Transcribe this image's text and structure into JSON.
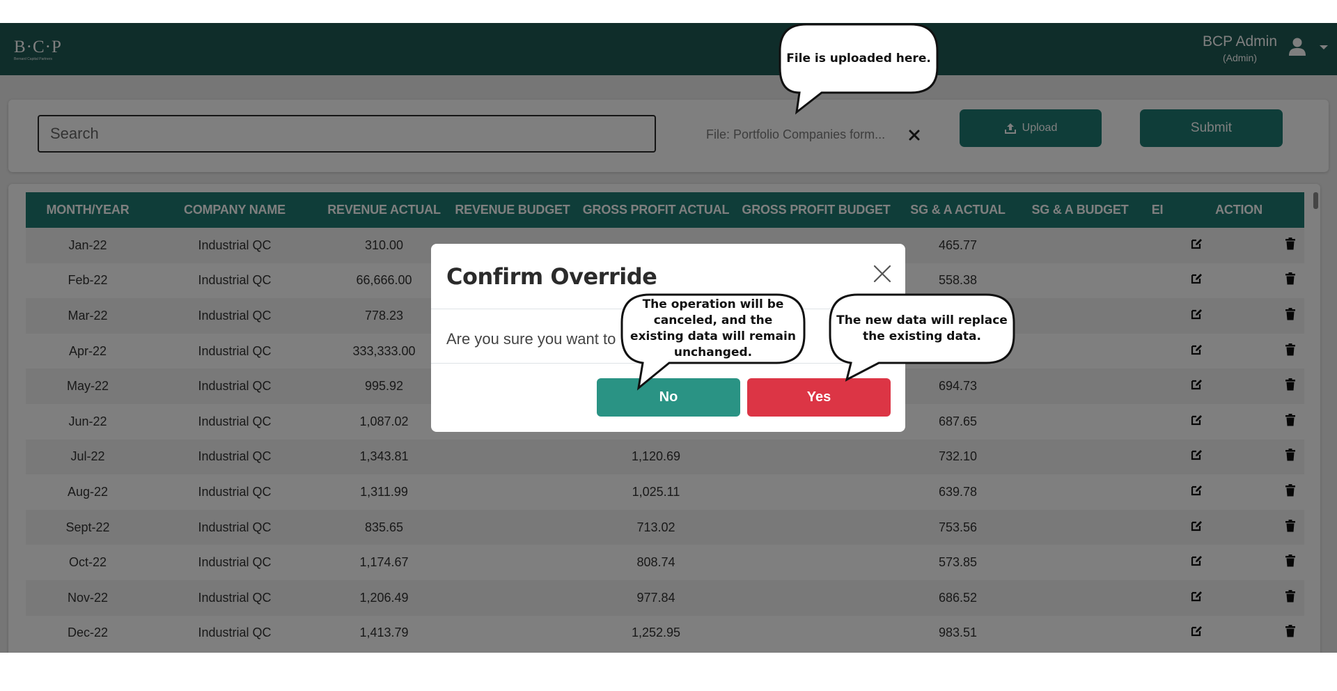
{
  "header": {
    "logo_text": "B·C·P",
    "logo_subtext": "Bernard Capital Partners",
    "user_name": "BCP Admin",
    "user_role": "(Admin)",
    "brand_color": "#1f5a54",
    "icons": {
      "user": "user-icon",
      "menu": "caret-down-icon"
    }
  },
  "toolbar": {
    "search_placeholder": "Search",
    "file_label": "File: Portfolio Companies form...",
    "upload_label": "Upload",
    "submit_label": "Submit",
    "accent_color": "#1f7b72"
  },
  "table": {
    "columns": [
      "MONTH/YEAR",
      "COMPANY NAME",
      "REVENUE ACTUAL",
      "REVENUE BUDGET",
      "GROSS PROFIT ACTUAL",
      "GROSS PROFIT BUDGET",
      "SG & A ACTUAL",
      "SG & A BUDGET",
      "EI",
      "ACTION"
    ],
    "rows": [
      {
        "month": "Jan-22",
        "company": "Industrial QC",
        "rev_actual": "310.00",
        "rev_budget": "",
        "gp_actual": "",
        "gp_budget": "",
        "sga_actual": "465.77",
        "sga_budget": ""
      },
      {
        "month": "Feb-22",
        "company": "Industrial QC",
        "rev_actual": "66,666.00",
        "rev_budget": "",
        "gp_actual": "",
        "gp_budget": "",
        "sga_actual": "558.38",
        "sga_budget": ""
      },
      {
        "month": "Mar-22",
        "company": "Industrial QC",
        "rev_actual": "778.23",
        "rev_budget": "",
        "gp_actual": "",
        "gp_budget": "",
        "sga_actual": "",
        "sga_budget": ""
      },
      {
        "month": "Apr-22",
        "company": "Industrial QC",
        "rev_actual": "333,333.00",
        "rev_budget": "",
        "gp_actual": "",
        "gp_budget": "",
        "sga_actual": "",
        "sga_budget": ""
      },
      {
        "month": "May-22",
        "company": "Industrial QC",
        "rev_actual": "995.92",
        "rev_budget": "",
        "gp_actual": "",
        "gp_budget": "",
        "sga_actual": "694.73",
        "sga_budget": ""
      },
      {
        "month": "Jun-22",
        "company": "Industrial QC",
        "rev_actual": "1,087.02",
        "rev_budget": "",
        "gp_actual": "",
        "gp_budget": "",
        "sga_actual": "687.65",
        "sga_budget": ""
      },
      {
        "month": "Jul-22",
        "company": "Industrial QC",
        "rev_actual": "1,343.81",
        "rev_budget": "",
        "gp_actual": "1,120.69",
        "gp_budget": "",
        "sga_actual": "732.10",
        "sga_budget": ""
      },
      {
        "month": "Aug-22",
        "company": "Industrial QC",
        "rev_actual": "1,311.99",
        "rev_budget": "",
        "gp_actual": "1,025.11",
        "gp_budget": "",
        "sga_actual": "639.78",
        "sga_budget": ""
      },
      {
        "month": "Sept-22",
        "company": "Industrial QC",
        "rev_actual": "835.65",
        "rev_budget": "",
        "gp_actual": "713.02",
        "gp_budget": "",
        "sga_actual": "753.56",
        "sga_budget": ""
      },
      {
        "month": "Oct-22",
        "company": "Industrial QC",
        "rev_actual": "1,174.67",
        "rev_budget": "",
        "gp_actual": "808.74",
        "gp_budget": "",
        "sga_actual": "573.85",
        "sga_budget": ""
      },
      {
        "month": "Nov-22",
        "company": "Industrial QC",
        "rev_actual": "1,206.49",
        "rev_budget": "",
        "gp_actual": "977.84",
        "gp_budget": "",
        "sga_actual": "686.52",
        "sga_budget": ""
      },
      {
        "month": "Dec-22",
        "company": "Industrial QC",
        "rev_actual": "1,413.79",
        "rev_budget": "",
        "gp_actual": "1,252.95",
        "gp_budget": "",
        "sga_actual": "983.51",
        "sga_budget": ""
      }
    ],
    "row_action_icons": [
      "edit-icon",
      "trash-icon"
    ]
  },
  "modal": {
    "title": "Confirm Override",
    "body": "Are you sure you want to",
    "no_label": "No",
    "yes_label": "Yes",
    "no_color": "#2a9384",
    "yes_color": "#dc3545"
  },
  "callouts": {
    "upload": "File is uploaded here.",
    "no": "The operation will be canceled, and the existing data will remain unchanged.",
    "yes": "The new data will replace the existing data."
  }
}
